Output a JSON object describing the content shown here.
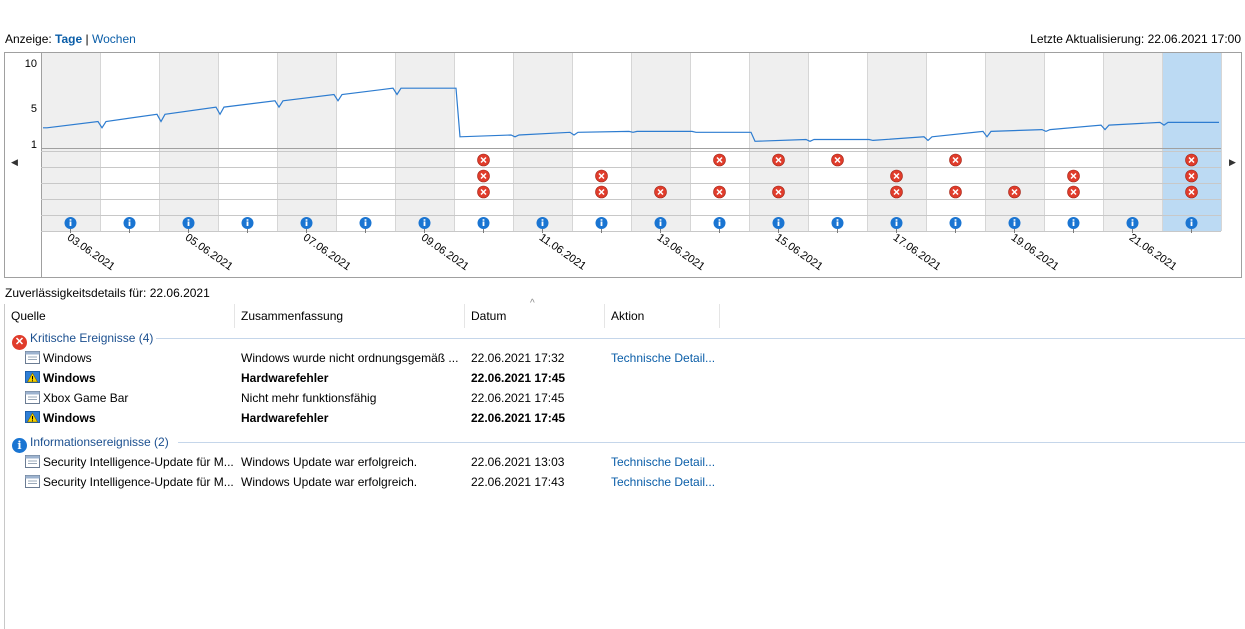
{
  "header": {
    "view_prefix": "Anzeige:",
    "view_days": "Tage",
    "view_sep": "|",
    "view_weeks": "Wochen",
    "last_update": "Letzte Aktualisierung: 22.06.2021 17:00"
  },
  "chart_data": {
    "type": "line",
    "y_ticks": [
      "10",
      "5",
      "1"
    ],
    "dates": [
      "03.06.2021",
      "04.06.2021",
      "05.06.2021",
      "06.06.2021",
      "07.06.2021",
      "08.06.2021",
      "09.06.2021",
      "10.06.2021",
      "11.06.2021",
      "12.06.2021",
      "13.06.2021",
      "14.06.2021",
      "15.06.2021",
      "16.06.2021",
      "17.06.2021",
      "18.06.2021",
      "19.06.2021",
      "20.06.2021",
      "21.06.2021",
      "22.06.2021"
    ],
    "x_tick_labels": [
      "03.06.2021",
      "05.06.2021",
      "07.06.2021",
      "09.06.2021",
      "11.06.2021",
      "13.06.2021",
      "15.06.2021",
      "17.06.2021",
      "19.06.2021",
      "21.06.2021"
    ],
    "stability_index": [
      2.8,
      3.5,
      4.3,
      5.1,
      5.8,
      6.5,
      7.2,
      1.8,
      2.0,
      2.3,
      2.4,
      2.3,
      1.3,
      1.5,
      1.4,
      1.8,
      2.4,
      2.6,
      3.1,
      3.4
    ],
    "selected_date": "22.06.2021",
    "event_rows": {
      "application_failures": [
        8,
        12,
        13,
        14,
        16,
        20
      ],
      "windows_failures": [
        8,
        10,
        15,
        18,
        20
      ],
      "misc_failures": [
        8,
        10,
        11,
        12,
        13,
        15,
        16,
        17,
        18,
        20
      ],
      "warnings": [],
      "information": [
        1,
        2,
        3,
        4,
        5,
        6,
        7,
        8,
        9,
        10,
        11,
        12,
        13,
        14,
        15,
        16,
        17,
        18,
        19,
        20
      ]
    },
    "colors": {
      "line": "#2d7cd0",
      "selected": "#bcdaf3",
      "band": "#efefef",
      "critical": "#e03c2b",
      "info": "#1a75d2"
    }
  },
  "details": {
    "title": "Zuverlässigkeitsdetails für: 22.06.2021",
    "columns": {
      "source": "Quelle",
      "summary": "Zusammenfassung",
      "date": "Datum",
      "action": "Aktion"
    },
    "sort_caret": "^",
    "critical_group": "Kritische Ereignisse (4)",
    "critical_rows": [
      {
        "source": "Windows",
        "summary": "Windows wurde nicht ordnungsgemäß ...",
        "date": "22.06.2021 17:32",
        "action": "Technische Detail...",
        "icon": "app-window-icon"
      },
      {
        "source": "Windows",
        "summary": "Hardwarefehler",
        "date": "22.06.2021 17:45",
        "action": "",
        "icon": "hardware-warning-icon"
      },
      {
        "source": "Xbox Game Bar",
        "summary": "Nicht mehr funktionsfähig",
        "date": "22.06.2021 17:45",
        "action": "",
        "icon": "app-window-icon"
      },
      {
        "source": "Windows",
        "summary": "Hardwarefehler",
        "date": "22.06.2021 17:45",
        "action": "",
        "icon": "hardware-warning-icon"
      }
    ],
    "info_group": "Informationsereignisse (2)",
    "info_rows": [
      {
        "source": "Security Intelligence-Update für M...",
        "summary": "Windows Update war erfolgreich.",
        "date": "22.06.2021 13:03",
        "action": "Technische Detail...",
        "icon": "app-window-icon"
      },
      {
        "source": "Security Intelligence-Update für M...",
        "summary": "Windows Update war erfolgreich.",
        "date": "22.06.2021 17:43",
        "action": "Technische Detail...",
        "icon": "app-window-icon"
      }
    ]
  }
}
